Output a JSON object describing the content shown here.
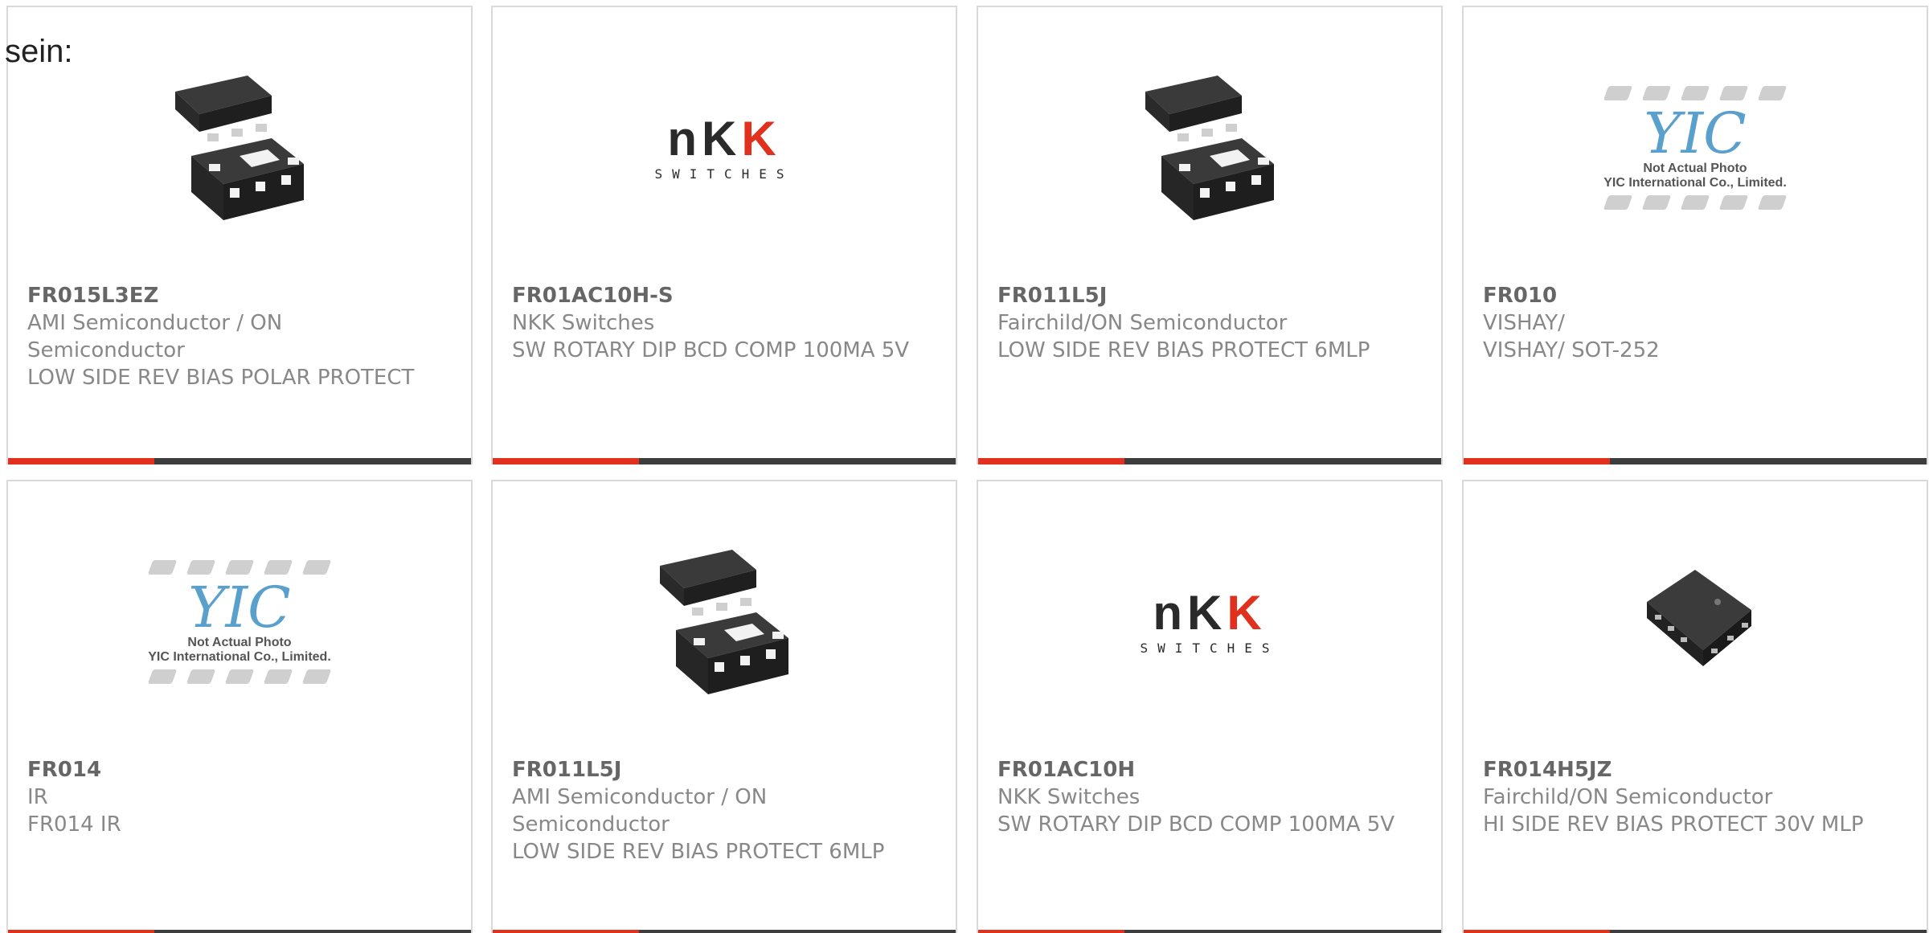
{
  "page": {
    "fragment_text": "sein:"
  },
  "colors": {
    "accent": "#e0301e",
    "bar": "#3d3d3d",
    "border": "#d9d9d9",
    "text": "#888888"
  },
  "products": [
    {
      "part_number": "FR015L3EZ",
      "manufacturer": "AMI Semiconductor / ON Semiconductor",
      "description": "LOW SIDE REV BIAS POLAR PROTECT",
      "image": "chip-package-icon"
    },
    {
      "part_number": "FR01AC10H-S",
      "manufacturer": "NKK Switches",
      "description": "SW ROTARY DIP BCD COMP 100MA 5V",
      "image": "nkk-switches-logo"
    },
    {
      "part_number": "FR011L5J",
      "manufacturer": "Fairchild/ON Semiconductor",
      "description": "LOW SIDE REV BIAS PROTECT 6MLP",
      "image": "chip-package-icon"
    },
    {
      "part_number": "FR010",
      "manufacturer": "VISHAY/",
      "description": "VISHAY/ SOT-252",
      "image": "yic-placeholder",
      "placeholder_lines": [
        "Not Actual Photo",
        "YIC International Co., Limited."
      ]
    },
    {
      "part_number": "FR014",
      "manufacturer": "IR",
      "description": "FR014 IR",
      "image": "yic-placeholder",
      "placeholder_lines": [
        "Not Actual Photo",
        "YIC International Co., Limited."
      ]
    },
    {
      "part_number": "FR011L5J",
      "manufacturer": "AMI Semiconductor / ON Semiconductor",
      "description": "LOW SIDE REV BIAS PROTECT 6MLP",
      "image": "chip-package-icon"
    },
    {
      "part_number": "FR01AC10H",
      "manufacturer": "NKK Switches",
      "description": "SW ROTARY DIP BCD COMP 100MA 5V",
      "image": "nkk-switches-logo"
    },
    {
      "part_number": "FR014H5JZ",
      "manufacturer": "Fairchild/ON Semiconductor",
      "description": "HI SIDE REV BIAS PROTECT 30V MLP",
      "image": "square-chip-icon"
    }
  ],
  "nkk_logo": {
    "wordmark_left": "nK",
    "wordmark_right": "K",
    "subtitle": "SWITCHES"
  }
}
